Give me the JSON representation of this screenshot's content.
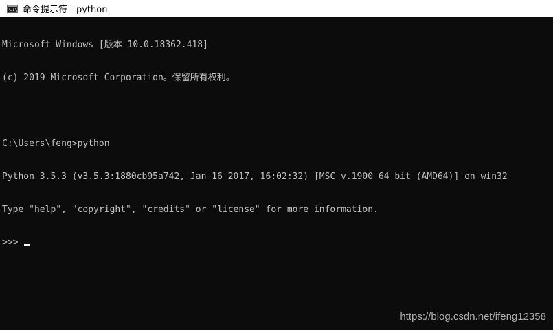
{
  "window": {
    "title": "命令提示符 - python",
    "icon": "cmd-icon"
  },
  "console": {
    "lines": [
      "Microsoft Windows [版本 10.0.18362.418]",
      "(c) 2019 Microsoft Corporation。保留所有权利。",
      "",
      "C:\\Users\\feng>python",
      "Python 3.5.3 (v3.5.3:1880cb95a742, Jan 16 2017, 16:02:32) [MSC v.1900 64 bit (AMD64)] on win32",
      "Type \"help\", \"copyright\", \"credits\" or \"license\" for more information."
    ],
    "prompt": ">>> "
  },
  "watermark": "https://blog.csdn.net/ifeng12358",
  "colors": {
    "background": "#0c0c0c",
    "text": "#c0c0c0",
    "titlebar": "#ffffff"
  }
}
